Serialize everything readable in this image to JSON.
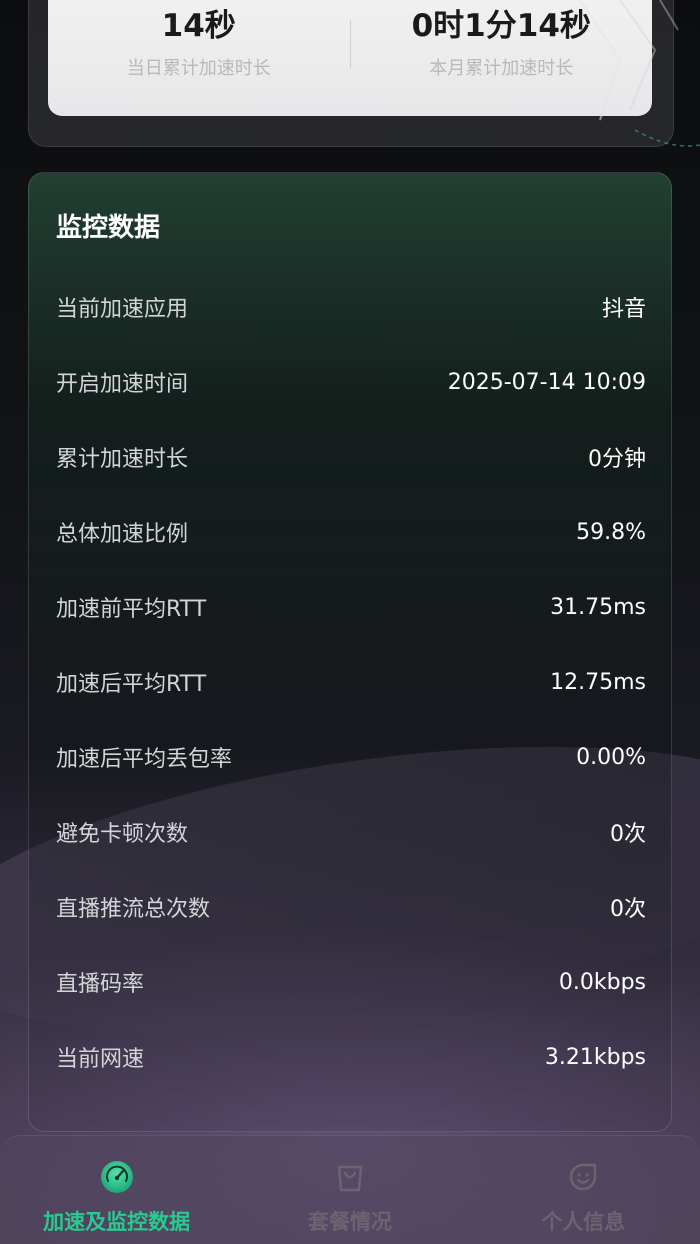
{
  "stats": {
    "today_value": "14秒",
    "today_label": "当日累计加速时长",
    "month_value": "0时1分14秒",
    "month_label": "本月累计加速时长"
  },
  "monitor": {
    "title": "监控数据",
    "rows": [
      {
        "label": "当前加速应用",
        "value": "抖音"
      },
      {
        "label": "开启加速时间",
        "value": "2025-07-14 10:09"
      },
      {
        "label": "累计加速时长",
        "value": "0分钟"
      },
      {
        "label": "总体加速比例",
        "value": "59.8%"
      },
      {
        "label": "加速前平均RTT",
        "value": "31.75ms"
      },
      {
        "label": "加速后平均RTT",
        "value": "12.75ms"
      },
      {
        "label": "加速后平均丢包率",
        "value": "0.00%"
      },
      {
        "label": "避免卡顿次数",
        "value": "0次"
      },
      {
        "label": "直播推流总次数",
        "value": "0次"
      },
      {
        "label": "直播码率",
        "value": "0.0kbps"
      },
      {
        "label": "当前网速",
        "value": "3.21kbps"
      }
    ]
  },
  "nav": {
    "items": [
      {
        "label": "加速及监控数据",
        "icon": "speedometer-icon",
        "active": true
      },
      {
        "label": "套餐情况",
        "icon": "shopping-bag-icon",
        "active": false
      },
      {
        "label": "个人信息",
        "icon": "smiley-face-icon",
        "active": false
      }
    ]
  },
  "colors": {
    "accent": "#29c98f",
    "inactive_nav": "#6b6470",
    "card_bg": "#ececee"
  }
}
